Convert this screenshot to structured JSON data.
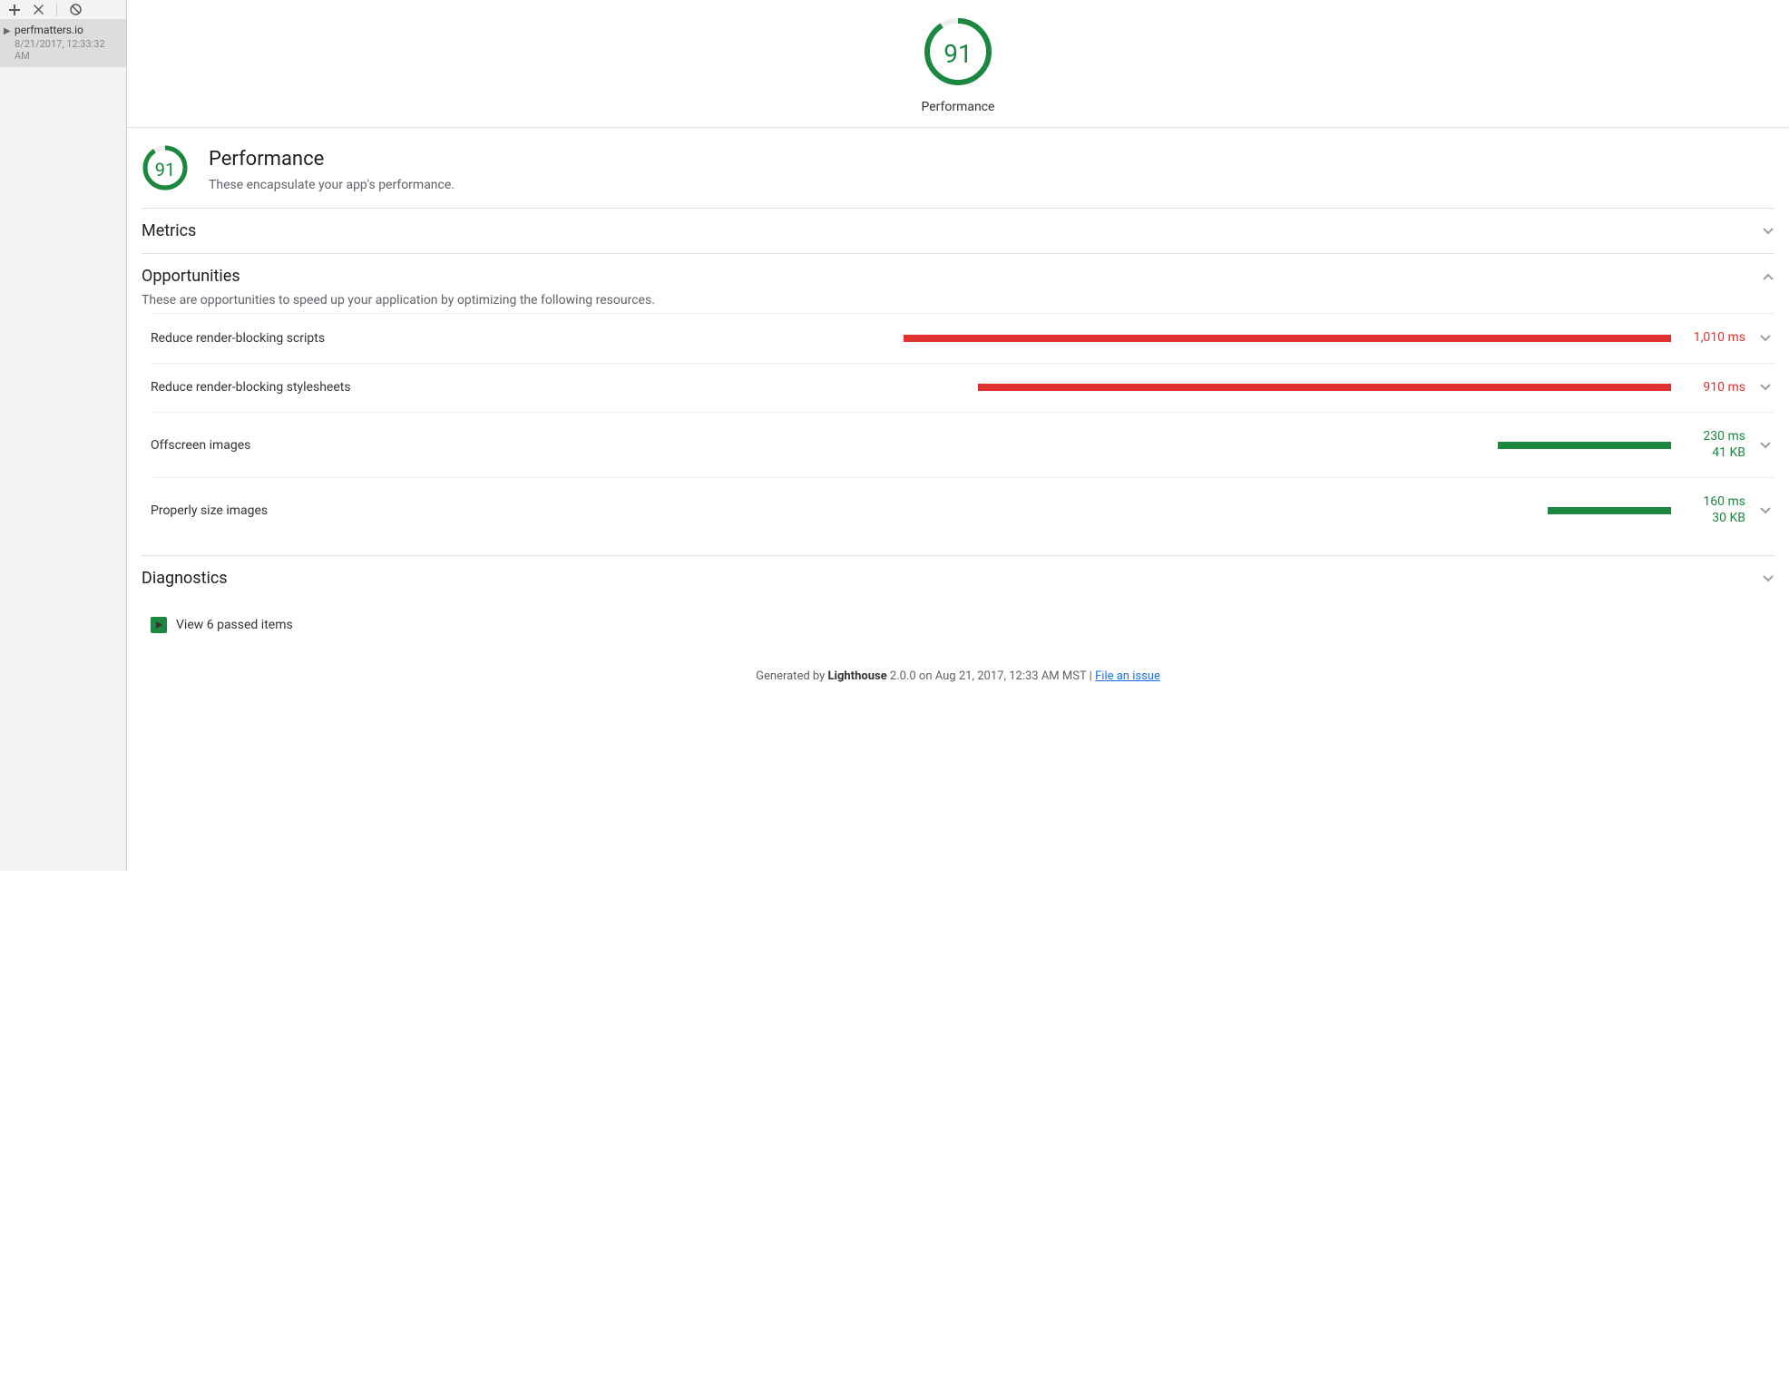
{
  "sidebar": {
    "audit": {
      "name": "perfmatters.io",
      "timestamp": "8/21/2017, 12:33:32 AM"
    }
  },
  "hero": {
    "score": "91",
    "caption": "Performance"
  },
  "category": {
    "score": "91",
    "title": "Performance",
    "subtitle": "These encapsulate your app's performance."
  },
  "sections": {
    "metrics": {
      "title": "Metrics"
    },
    "opportunities": {
      "title": "Opportunities",
      "desc": "These are opportunities to speed up your application by optimizing the following resources."
    },
    "diagnostics": {
      "title": "Diagnostics"
    }
  },
  "opps": [
    {
      "name": "Reduce render-blocking scripts",
      "ms": "1,010 ms",
      "kb": "",
      "color": "red",
      "widthPct": 62
    },
    {
      "name": "Reduce render-blocking stylesheets",
      "ms": "910 ms",
      "kb": "",
      "color": "red",
      "widthPct": 56
    },
    {
      "name": "Offscreen images",
      "ms": "230 ms",
      "kb": "41 KB",
      "color": "green",
      "widthPct": 14
    },
    {
      "name": "Properly size images",
      "ms": "160 ms",
      "kb": "30 KB",
      "color": "green",
      "widthPct": 10
    }
  ],
  "passed": {
    "label": "View 6 passed items"
  },
  "footer": {
    "prefix": "Generated by ",
    "tool": "Lighthouse",
    "rest": " 2.0.0 on Aug 21, 2017, 12:33 AM MST | ",
    "link": "File an issue"
  },
  "colors": {
    "good": "#1b873f",
    "bad": "#df332f"
  }
}
